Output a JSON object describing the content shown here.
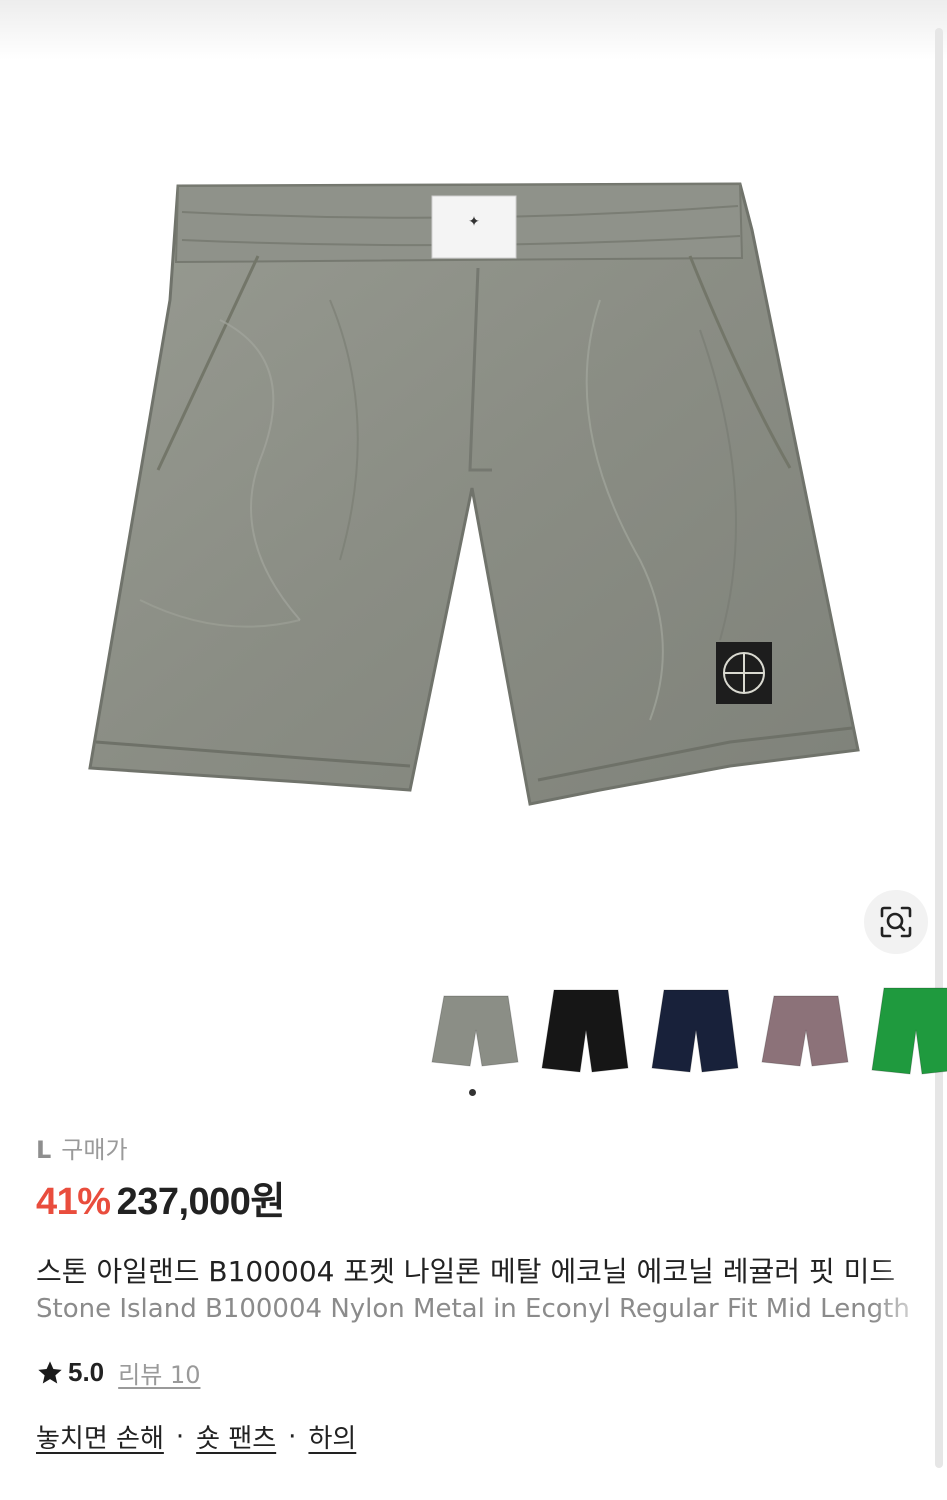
{
  "product": {
    "size_label": "L",
    "purchase_label": "구매가",
    "discount": "41%",
    "price": "237,000원",
    "title_kr": "스톤 아일랜드 B100004 포켓 나일론 메탈 에코닐 에코닐 레귤러 핏 미드",
    "title_en": "Stone Island B100004 Nylon Metal in Econyl Regular Fit Mid Length",
    "rating": "5.0",
    "reviews": "리뷰 10"
  },
  "tags": [
    "놓치면 손해",
    "숏 팬츠",
    "하의"
  ],
  "tag_separator": "·",
  "thumbnails": [
    {
      "name": "gray",
      "color": "#8b8e86"
    },
    {
      "name": "black",
      "color": "#161616"
    },
    {
      "name": "navy",
      "color": "#18213a"
    },
    {
      "name": "mauve",
      "color": "#8c7279"
    },
    {
      "name": "green",
      "color": "#1f9a3e"
    }
  ],
  "colors": {
    "accent_red": "#e94d3d",
    "shorts_main": "#8d9087",
    "shorts_shadow": "#6f726a"
  },
  "icons": {
    "scan": "image-search-icon",
    "star": "star-icon"
  }
}
